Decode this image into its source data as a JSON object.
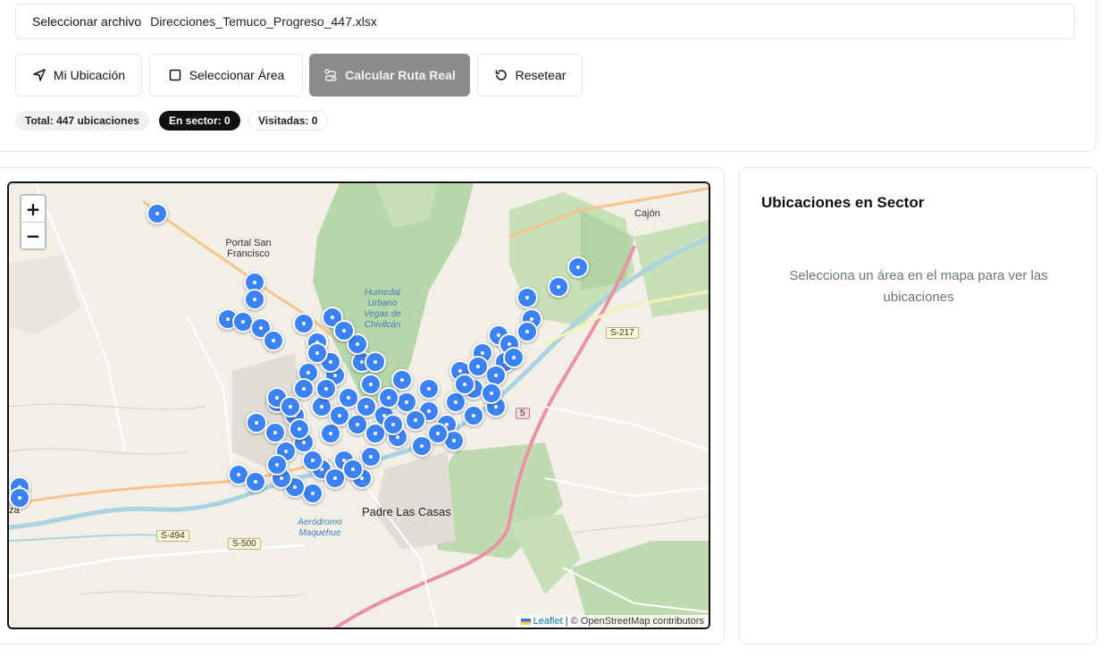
{
  "file": {
    "button_label": "Seleccionar archivo",
    "file_name": "Direcciones_Temuco_Progreso_447.xlsx"
  },
  "toolbar": {
    "my_location": "Mi Ubicación",
    "select_area": "Seleccionar Área",
    "calc_route": "Calcular Ruta Real",
    "reset": "Resetear"
  },
  "stats": {
    "total": "Total: 447 ubicaciones",
    "in_sector": "En sector: 0",
    "visited": "Visitadas: 0"
  },
  "map": {
    "zoom_in": "+",
    "zoom_out": "−",
    "attribution_link": "Leaflet",
    "attribution_text": "| © OpenStreetMap contributors",
    "labels": {
      "portal": "Portal San Francisco",
      "humedal": "Humedal Urbano Vegas de Chivilcán",
      "cajon": "Cajón",
      "padre": "Padre Las Casas",
      "aerodromo": "Aeródromo Maquehue",
      "za": "za"
    },
    "road_shields": {
      "s217": "S-217",
      "r5": "5",
      "s494": "S-494",
      "s500": "S-500"
    },
    "colors": {
      "marker": "#3b82f6",
      "land": "#f2efe9",
      "forest": "#add19e",
      "water": "#aad3df",
      "highway": "#e892a2",
      "secondary": "#f7c388"
    }
  },
  "panel": {
    "title": "Ubicaciones en Sector",
    "empty_text": "Selecciona un área en el mapa para ver las ubicaciones"
  }
}
